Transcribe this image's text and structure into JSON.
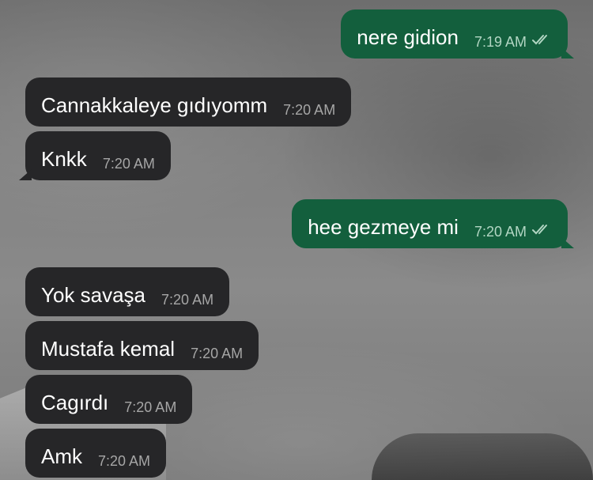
{
  "chat": {
    "messages": [
      {
        "direction": "outgoing",
        "text": "nere gidion",
        "time": "7:19 AM",
        "status_icon": "double-check-icon"
      },
      {
        "direction": "incoming",
        "text": "Cannakkaleye gıdıyomm",
        "time": "7:20 AM"
      },
      {
        "direction": "incoming",
        "text": "Knkk",
        "time": "7:20 AM"
      },
      {
        "direction": "outgoing",
        "text": "hee gezmeye mi",
        "time": "7:20 AM",
        "status_icon": "double-check-icon"
      },
      {
        "direction": "incoming",
        "text": "Yok savaşa",
        "time": "7:20 AM"
      },
      {
        "direction": "incoming",
        "text": "Mustafa kemal",
        "time": "7:20 AM"
      },
      {
        "direction": "incoming",
        "text": "Cagırdı",
        "time": "7:20 AM"
      },
      {
        "direction": "incoming",
        "text": "Amk",
        "time": "7:20 AM"
      }
    ]
  },
  "colors": {
    "incoming_bubble": "#262628",
    "outgoing_bubble": "#135f3d",
    "text": "#ffffff",
    "timestamp": "#a6a6a6"
  }
}
